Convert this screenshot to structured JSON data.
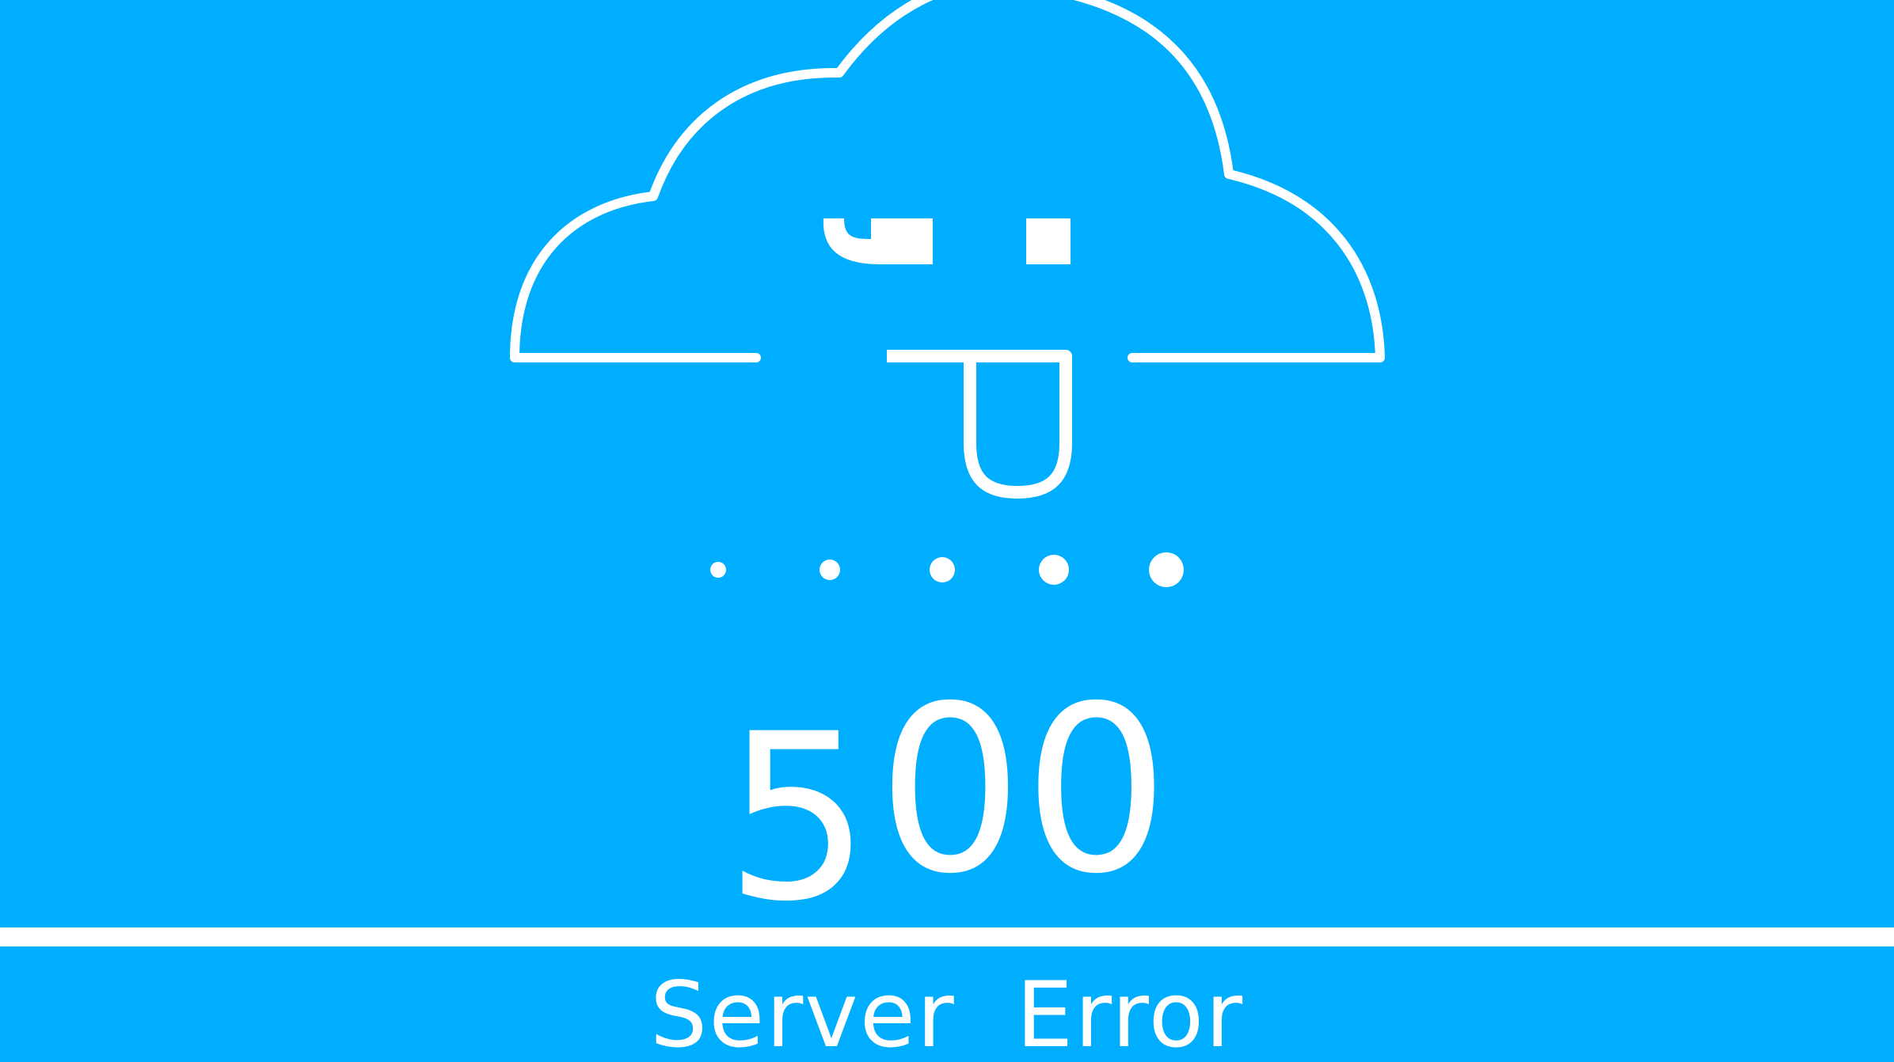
{
  "colors": {
    "background": "#00aeff",
    "foreground": "#ffffff"
  },
  "illustration": {
    "icon": "cloud-tongue-out-face-icon",
    "loading_dots": 5
  },
  "error": {
    "code_first_digit": "5",
    "code_rest": "00",
    "message": "Server  Error"
  }
}
